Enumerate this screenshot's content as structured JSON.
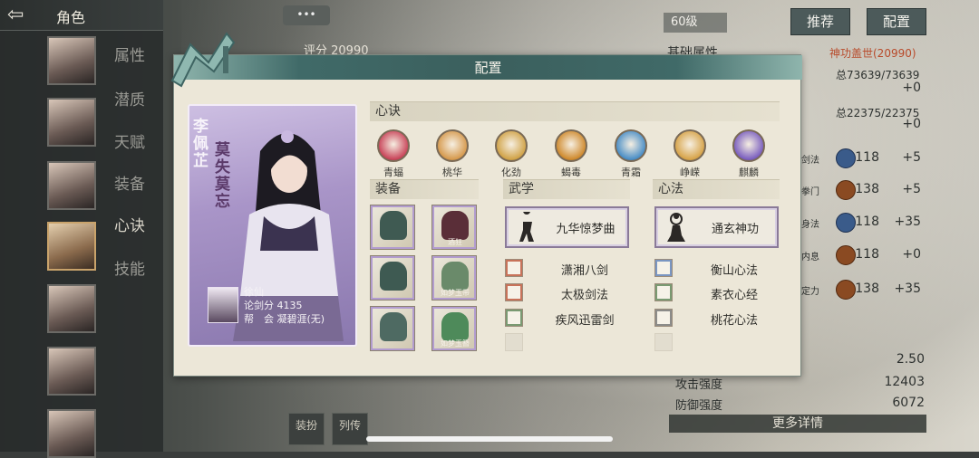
{
  "header": {
    "back_icon": "arrow-left-icon",
    "title": "角色"
  },
  "sidebar": {
    "items": [
      {
        "label": "属性",
        "active": false
      },
      {
        "label": "潜质",
        "active": false
      },
      {
        "label": "天赋",
        "active": false
      },
      {
        "label": "装备",
        "active": false
      },
      {
        "label": "心诀",
        "active": true
      },
      {
        "label": "技能",
        "active": false
      }
    ]
  },
  "background": {
    "chat_bubble": "•••",
    "score": "评分 20990",
    "level": "60级",
    "recommend_button": "推荐",
    "config_button": "配置",
    "base_attr_label": "基础属性",
    "power_title": "神功盖世(20990)",
    "hp": "总73639/73639",
    "hp_delta": "+0",
    "mp": "总22375/22375",
    "mp_delta": "+0",
    "stats": [
      {
        "label": "剑法",
        "value": "118",
        "delta": "+5"
      },
      {
        "label": "拳门",
        "value": "138",
        "delta": "+5"
      },
      {
        "label": "身法",
        "value": "118",
        "delta": "+35"
      },
      {
        "label": "内息",
        "value": "118",
        "delta": "+0"
      },
      {
        "label": "定力",
        "value": "138",
        "delta": "+35"
      }
    ],
    "crit_value": "2.50",
    "attack_label": "攻击强度",
    "attack_value": "12403",
    "defense_label": "防御强度",
    "defense_value": "6072",
    "more_details": "更多详情",
    "bottom_tabs": [
      "装扮",
      "列传"
    ]
  },
  "modal": {
    "title": "配置",
    "character": {
      "name": "李佩芷",
      "title_text": "莫失莫忘",
      "sect": "徐仙",
      "rank_label": "论剑分",
      "rank_value": "4135",
      "guild_label": "帮　会",
      "guild_value": "凝碧涯(无)"
    },
    "xinjue_header": "心诀",
    "xinjue": [
      {
        "label": "青蝠",
        "color": "#c9455a",
        "icon": "bat-icon"
      },
      {
        "label": "桃华",
        "color": "#d69a4e",
        "icon": "blossom-icon"
      },
      {
        "label": "化劲",
        "color": "#d1a348",
        "icon": "swirl-icon"
      },
      {
        "label": "蝎毒",
        "color": "#cf8a2e",
        "icon": "scorpion-icon"
      },
      {
        "label": "青霜",
        "color": "#4a8ec6",
        "icon": "snowflake-icon"
      },
      {
        "label": "峥嵘",
        "color": "#d7a44a",
        "icon": "peak-icon"
      },
      {
        "label": "麒麟",
        "color": "#7b5fbf",
        "icon": "qilin-icon"
      }
    ],
    "equip_header": "装备",
    "equipment": [
      {
        "label": "",
        "icon": "hood-icon",
        "color": "#3f5a52"
      },
      {
        "label": "酒狂",
        "icon": "qin-icon",
        "color": "#5a2e38"
      },
      {
        "label": "",
        "icon": "robe-icon",
        "color": "#3e5a52"
      },
      {
        "label": "如梦玉带",
        "icon": "belt-icon",
        "color": "#6a8a6a"
      },
      {
        "label": "",
        "icon": "boots-icon",
        "color": "#4e6a62"
      },
      {
        "label": "如梦玉簪",
        "icon": "hairpin-icon",
        "color": "#4e8a5a"
      }
    ],
    "wuxue_header": "武学",
    "wuxue_main": "九华惊梦曲",
    "wuxue_list": [
      {
        "label": "潇湘八剑",
        "tint": "red"
      },
      {
        "label": "太极剑法",
        "tint": "red"
      },
      {
        "label": "疾风迅雷剑",
        "tint": "green"
      },
      {
        "label": "",
        "tint": "empty"
      }
    ],
    "xinfa_header": "心法",
    "xinfa_main": "通玄神功",
    "xinfa_list": [
      {
        "label": "衡山心法",
        "tint": "blue"
      },
      {
        "label": "素衣心经",
        "tint": "green"
      },
      {
        "label": "桃花心法",
        "tint": "gray"
      },
      {
        "label": "",
        "tint": "empty"
      }
    ]
  }
}
